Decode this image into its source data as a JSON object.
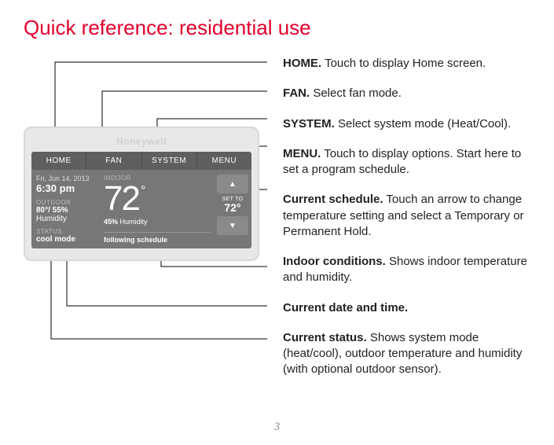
{
  "title": "Quick reference: residential use",
  "page_number": "3",
  "thermostat": {
    "brand": "Honeywell",
    "nav": {
      "home": "HOME",
      "fan": "FAN",
      "system": "SYSTEM",
      "menu": "MENU"
    },
    "date": "Fri, Jun 14, 2013",
    "time": "6:30 pm",
    "outdoor_label": "OUTDOOR",
    "outdoor_value_bold": "80°/ 55%",
    "outdoor_value_rest": " Humidity",
    "status_label": "STATUS",
    "status_value": "cool mode",
    "indoor_label": "INDOOR",
    "indoor_temp": "72",
    "indoor_deg": "°",
    "indoor_hum_bold": "45%",
    "indoor_hum_rest": " Humidity",
    "schedule_line": "following schedule",
    "set_to_label": "SET TO",
    "set_to_value": "72°",
    "arrow_up": "▲",
    "arrow_down": "▼"
  },
  "callouts": {
    "home": {
      "bold": "HOME.",
      "text": " Touch to display Home screen."
    },
    "fan": {
      "bold": "FAN.",
      "text": " Select fan mode."
    },
    "system": {
      "bold": "SYSTEM.",
      "text": " Select system mode (Heat/Cool)."
    },
    "menu": {
      "bold": "MENU.",
      "text": " Touch to display options. Start here to set a program schedule."
    },
    "sched": {
      "bold": "Current schedule.",
      "text": " Touch an arrow to change temperature setting and select a Temporary or Permanent Hold."
    },
    "indoor": {
      "bold": "Indoor conditions.",
      "text": " Shows indoor temperature and humidity."
    },
    "datetime": {
      "bold": "Current date and time.",
      "text": ""
    },
    "status": {
      "bold": "Current status.",
      "text": " Shows system mode (heat/cool), outdoor temperature and humidity (with optional outdoor sensor)."
    }
  }
}
